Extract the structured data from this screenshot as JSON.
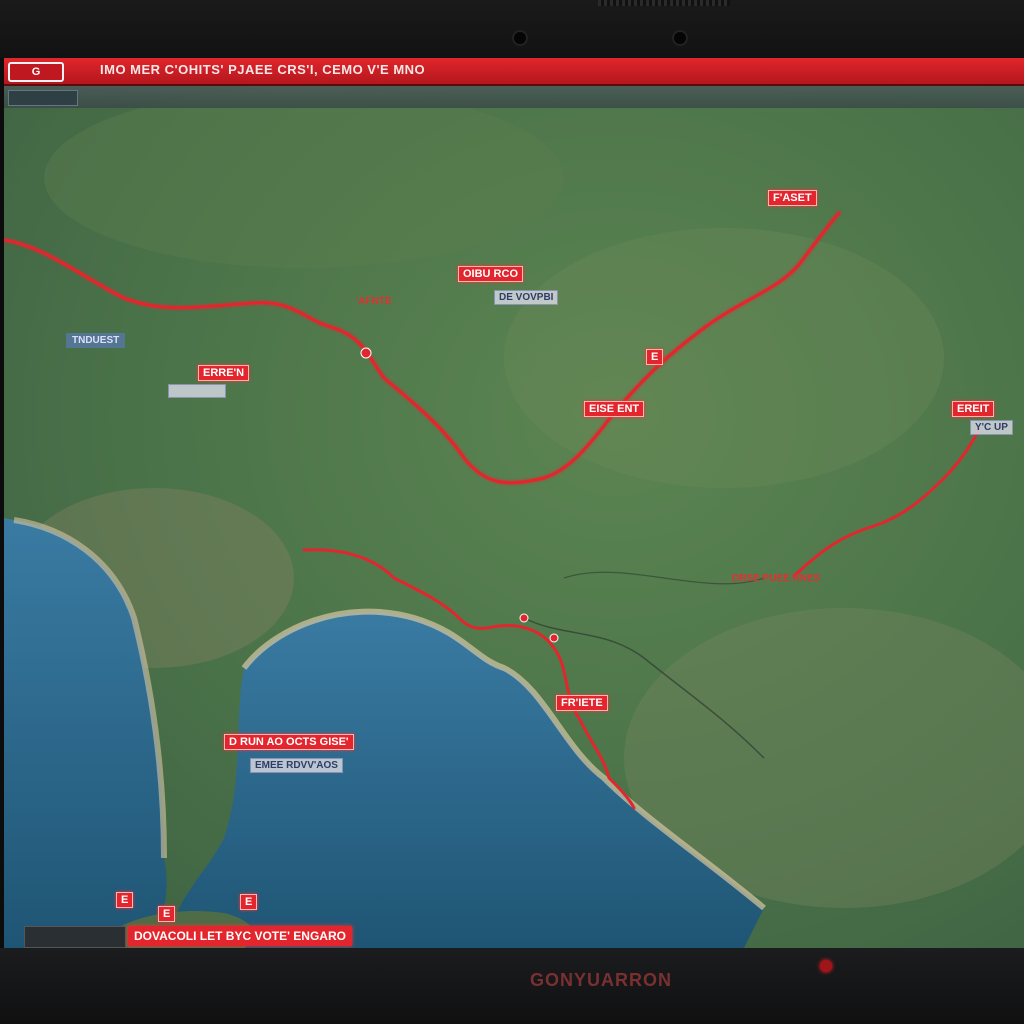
{
  "window": {
    "logo_text": "G",
    "title": "IMO MER C'OHITS' PJAEE CRS'I, CEMO V'E MNO"
  },
  "toolbar": {
    "button_label": "",
    "breadcrumb": ""
  },
  "map": {
    "route_color": "#e3262d",
    "water_color": "#2f6d93",
    "land_color": "#4f7a4f",
    "labels_red": [
      {
        "id": "north-east",
        "text": "F'ASET"
      },
      {
        "id": "center-north",
        "text": "OIBU RCO"
      },
      {
        "id": "west",
        "text": "ERRE'N"
      },
      {
        "id": "center",
        "text": "EISE ENT"
      },
      {
        "id": "junction-east",
        "text": "E"
      },
      {
        "id": "far-east",
        "text": "EREIT"
      },
      {
        "id": "coast-east",
        "text": "FR'IETE"
      },
      {
        "id": "bay",
        "text": "D RUN AO OCTS GISE'"
      },
      {
        "id": "south-west-1",
        "text": "E"
      },
      {
        "id": "south-west-2",
        "text": "E"
      },
      {
        "id": "south-west-3",
        "text": "E"
      }
    ],
    "labels_grey": [
      {
        "id": "center-sub",
        "text": "DE VOVPBI"
      },
      {
        "id": "west-sub",
        "text": ""
      },
      {
        "id": "far-east-sub",
        "text": "Y'C UP"
      },
      {
        "id": "bay-sub",
        "text": "EMEE RDVV'AOS"
      }
    ],
    "labels_blue": [
      {
        "id": "west-region",
        "text": "TNDUEST"
      }
    ],
    "labels_plain": [
      {
        "id": "river-east",
        "text": "DRSE PUEE RNES"
      },
      {
        "id": "center-west",
        "text": "'AFNTE"
      }
    ]
  },
  "statusbar": {
    "caption": "",
    "text": "DOVACOLI LET BYC VOTE' ENGARO"
  },
  "monitor": {
    "brand": "GONYUARRON"
  }
}
